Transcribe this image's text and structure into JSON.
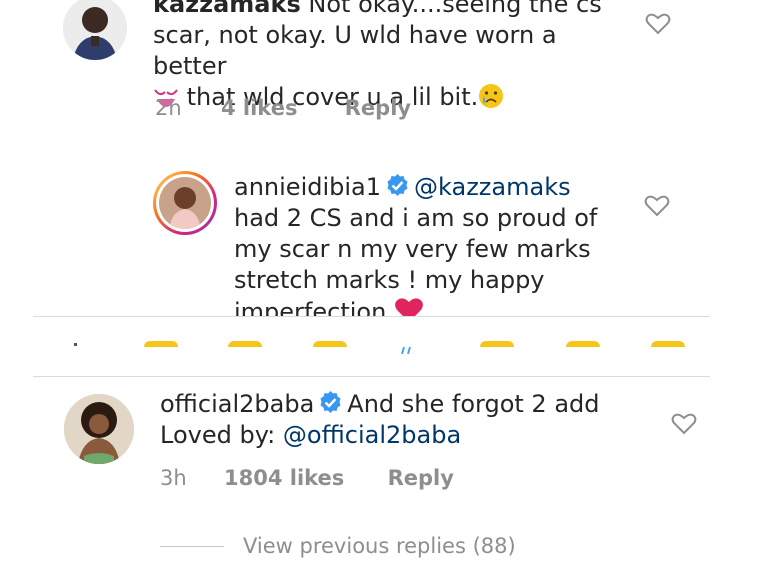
{
  "comments": [
    {
      "username": "kazzamaks",
      "text_line1": "Not okay....seeing the cs",
      "text_line2": "scar, not okay. U wld have worn a better",
      "text_line3": "that wld cover u a lil bit.",
      "time": "2h",
      "likes": "4 likes",
      "reply": "Reply"
    },
    {
      "username": "annieidibia1",
      "mention": "@kazzamaks",
      "text_line1": "had 2 CS and i am so proud of",
      "text_line2": "my scar n my very few marks",
      "text_line3": "stretch marks ! my happy",
      "text_line4": "imperfection"
    },
    {
      "username": "official2baba",
      "text_line1": "And she forgot 2 add",
      "loved_by_prefix": "Loved by:",
      "loved_by_user": "@official2baba",
      "time": "3h",
      "likes": "1804 likes",
      "reply": "Reply",
      "view_replies": "View previous replies (88)"
    }
  ],
  "colors": {
    "text": "#262626",
    "meta": "#8e8e8e",
    "mention": "#00376b",
    "verified": "#3897f0",
    "heart": "#8e8e8e",
    "emoji_yellow": "#f5c518",
    "red_heart": "#e0245e"
  }
}
